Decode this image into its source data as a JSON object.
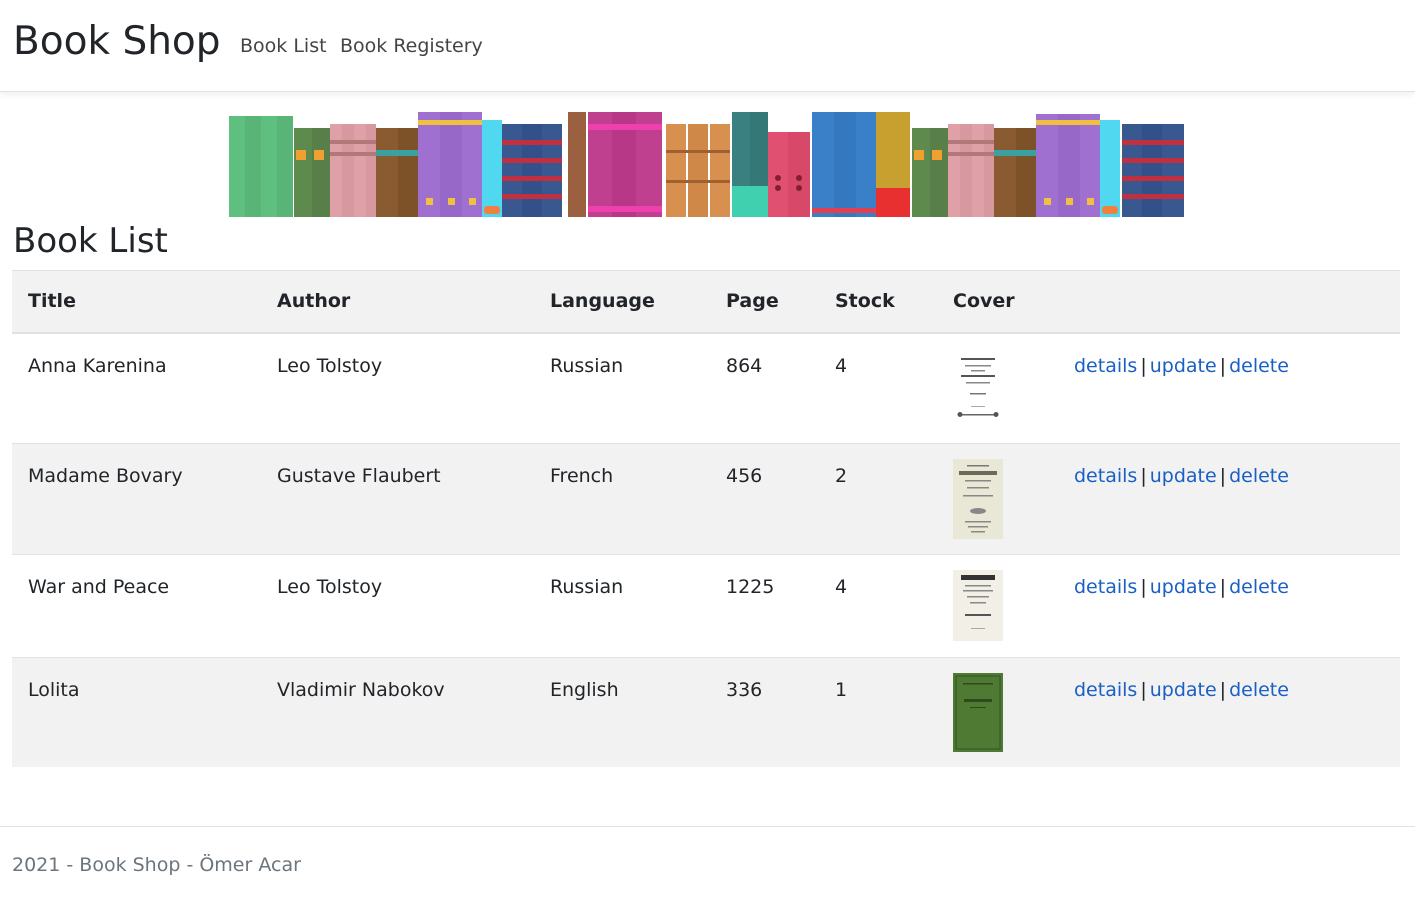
{
  "navbar": {
    "brand": "Book Shop",
    "links": [
      "Book List",
      "Book Registery"
    ]
  },
  "page": {
    "title": "Book List"
  },
  "table": {
    "headers": [
      "Title",
      "Author",
      "Language",
      "Page",
      "Stock",
      "Cover"
    ],
    "rows": [
      {
        "title": "Anna Karenina",
        "author": "Leo Tolstoy",
        "language": "Russian",
        "page": "864",
        "stock": "4"
      },
      {
        "title": "Madame Bovary",
        "author": "Gustave Flaubert",
        "language": "French",
        "page": "456",
        "stock": "2"
      },
      {
        "title": "War and Peace",
        "author": "Leo Tolstoy",
        "language": "Russian",
        "page": "1225",
        "stock": "4"
      },
      {
        "title": "Lolita",
        "author": "Vladimir Nabokov",
        "language": "English",
        "page": "336",
        "stock": "1"
      }
    ],
    "actions": {
      "details": "details",
      "update": "update",
      "delete": "delete",
      "separator": "|"
    }
  },
  "footer": {
    "text": "2021 - Book Shop - Ömer Acar"
  },
  "colors": {
    "link": "#1a5fc4",
    "stripe": "#f2f2f2",
    "muted": "#6c757d"
  }
}
